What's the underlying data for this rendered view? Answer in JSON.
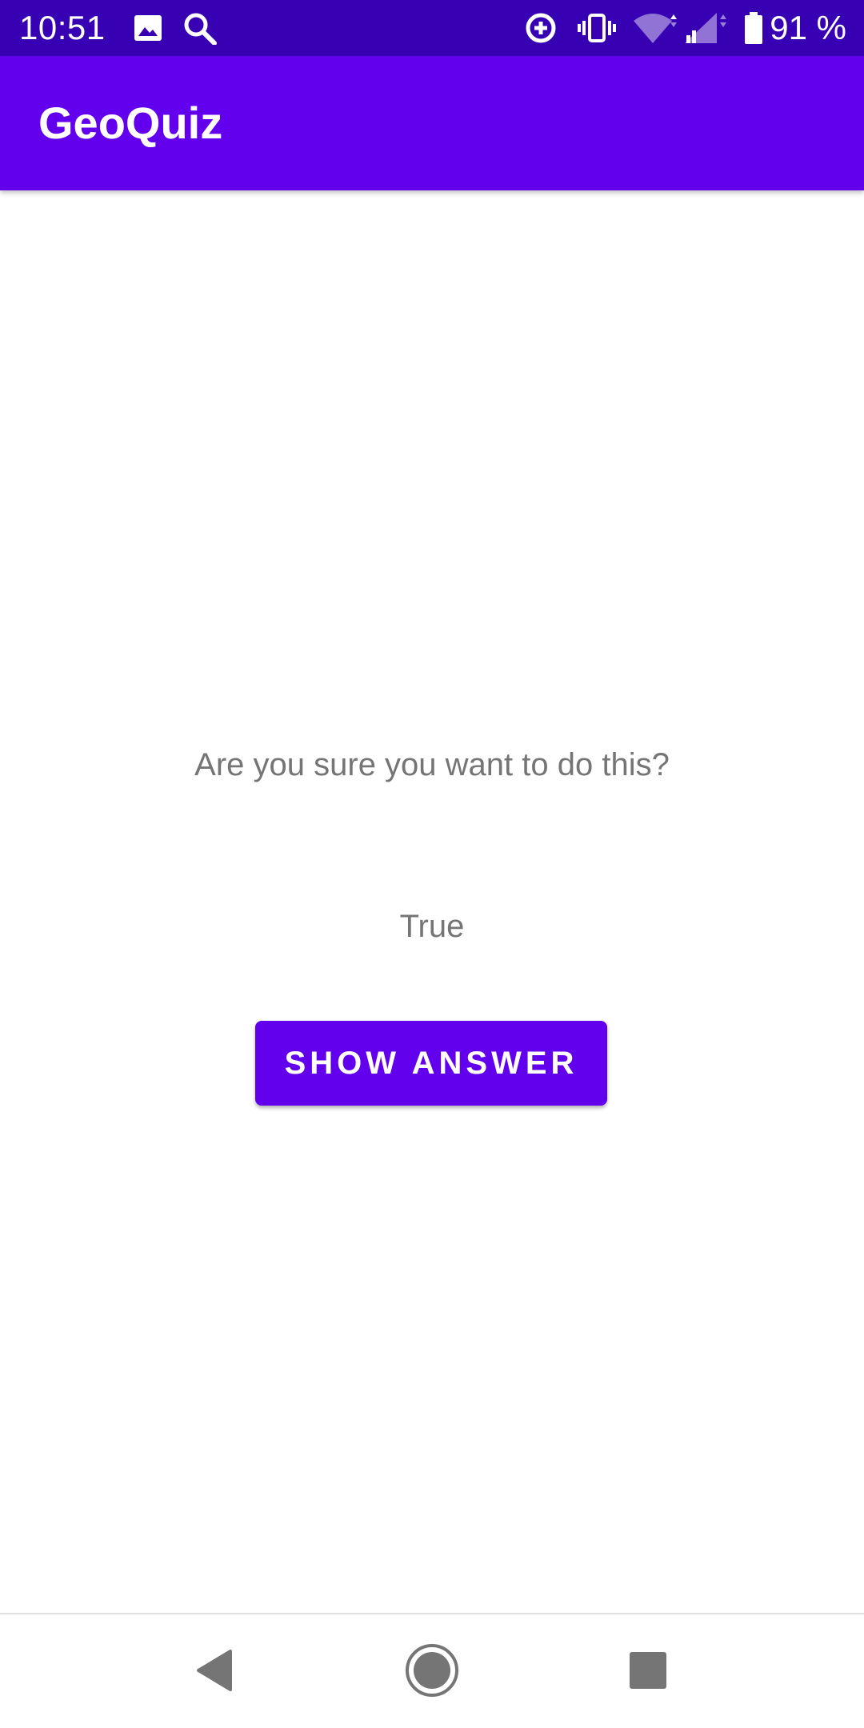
{
  "status_bar": {
    "time": "10:51",
    "battery_percent": "91 %",
    "icons": [
      "image-icon",
      "search-icon",
      "data-saver-icon",
      "vibrate-icon",
      "wifi-icon",
      "cell-signal-icon",
      "battery-icon"
    ],
    "background_color": "#3700B3"
  },
  "app_bar": {
    "title": "GeoQuiz",
    "background_color": "#6200EE"
  },
  "main": {
    "warning_text": "Are you sure you want to do this?",
    "answer_text": "True",
    "show_answer_label": "SHOW ANSWER",
    "button_color": "#6200EE",
    "text_color": "#757575"
  },
  "nav_bar": {
    "icons": [
      "back-icon",
      "home-icon",
      "recents-icon"
    ]
  }
}
